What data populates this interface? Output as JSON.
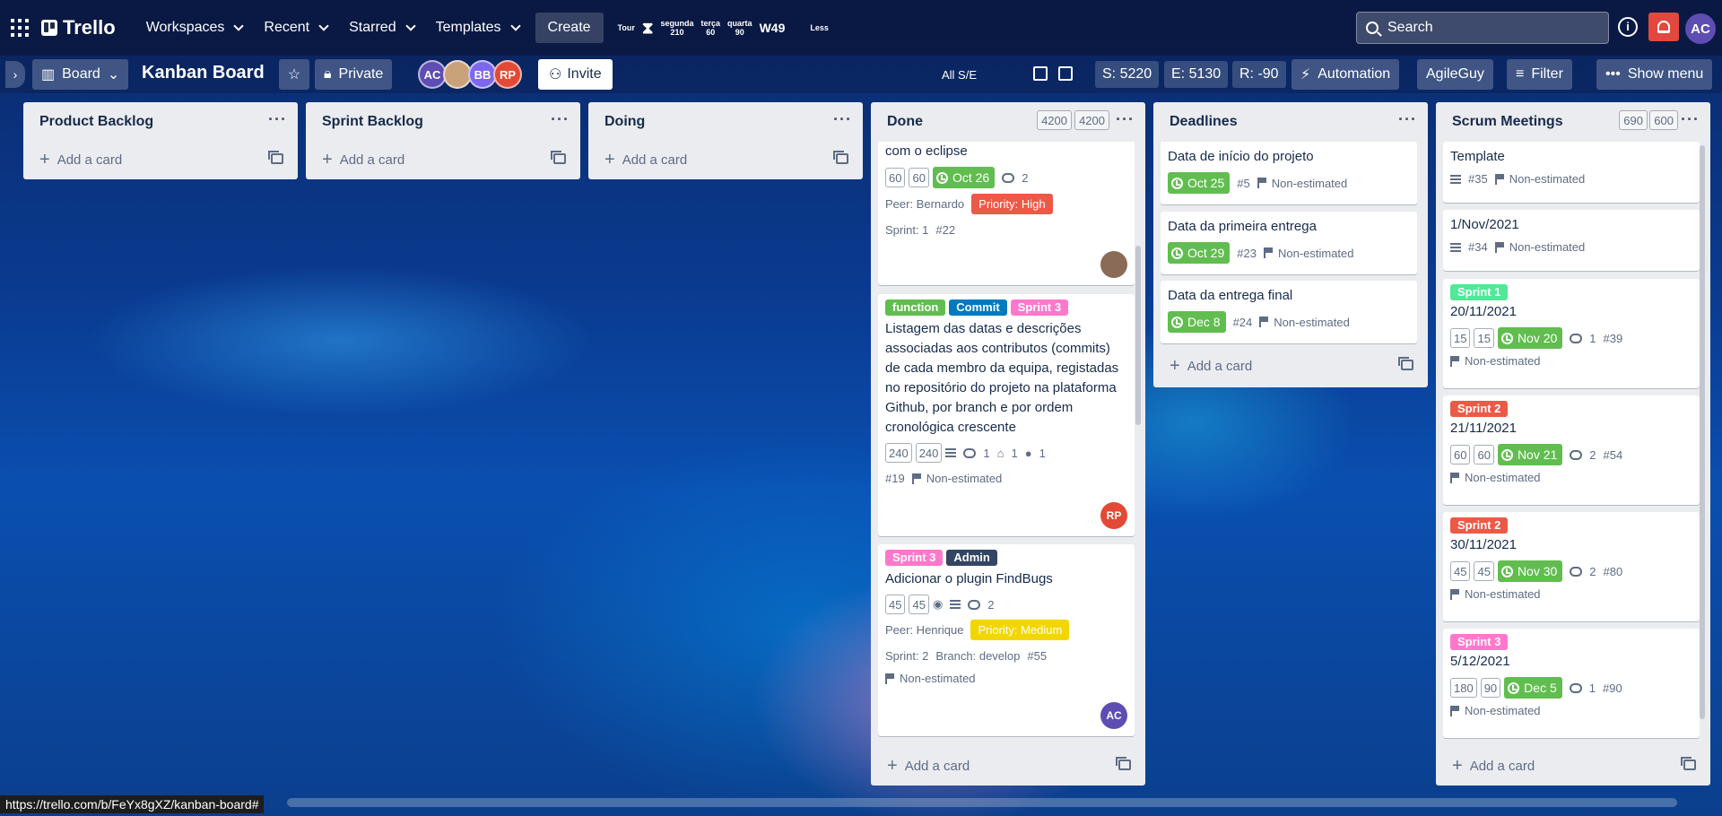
{
  "nav": {
    "brand": "Trello",
    "items": [
      "Workspaces",
      "Recent",
      "Starred",
      "Templates"
    ],
    "create": "Create",
    "widgets": {
      "tour": "Tour",
      "cols": [
        {
          "day": "segunda",
          "num": "210"
        },
        {
          "day": "terça",
          "num": "60"
        },
        {
          "day": "quarta",
          "num": "90"
        }
      ],
      "week": "W49",
      "less": "Less"
    },
    "search_placeholder": "Search",
    "user_initials": "AC"
  },
  "board": {
    "view": "Board",
    "title": "Kanban Board",
    "visibility": "Private",
    "members": [
      {
        "initials": "AC",
        "color": "#5e4db2"
      },
      {
        "initials": "",
        "color": "#c9a27a"
      },
      {
        "initials": "BB",
        "color": "#7b68ee"
      },
      {
        "initials": "RP",
        "color": "#e34935"
      }
    ],
    "invite": "Invite",
    "filter_scope": "All S/E",
    "stats": {
      "s": "S: 5220",
      "e": "E: 5130",
      "r": "R: -90"
    },
    "automation": "Automation",
    "user_pill": "AgileGuy",
    "filter": "Filter",
    "show_menu": "Show menu"
  },
  "common": {
    "add_card": "Add a card",
    "non_estimated": "Non-estimated"
  },
  "lists": {
    "product_backlog": {
      "title": "Product Backlog"
    },
    "sprint_backlog": {
      "title": "Sprint Backlog"
    },
    "doing": {
      "title": "Doing"
    },
    "done": {
      "title": "Done",
      "counts": [
        "4200",
        "4200"
      ],
      "cards": [
        {
          "title": "com o eclipse",
          "est": [
            "60",
            "60"
          ],
          "due": "Oct 26",
          "comments": "2",
          "peer": "Peer: Bernardo",
          "priority": "Priority: High",
          "sprint": "Sprint: 1",
          "id": "#22"
        },
        {
          "labels": [
            "function",
            "Commit",
            "Sprint 3"
          ],
          "title": "Listagem das datas e descrições associadas aos contributos (commits) de cada membro da equipa, registadas no repositório do projeto na plataforma Github, por branch e por ordem cronológica crescente",
          "est": [
            "240",
            "240"
          ],
          "comments": "1",
          "attachments": "1",
          "github": "1",
          "id": "#19",
          "non_estimated": "Non-estimated",
          "avatar": "RP"
        },
        {
          "labels": [
            "Sprint 3",
            "Admin"
          ],
          "title": "Adicionar o plugin FindBugs",
          "est": [
            "45",
            "45"
          ],
          "comments": "2",
          "peer": "Peer: Henrique",
          "priority": "Priority: Medium",
          "sprint": "Sprint: 2",
          "branch": "Branch: develop",
          "id": "#55",
          "non_estimated": "Non-estimated",
          "avatar": "AC"
        }
      ]
    },
    "deadlines": {
      "title": "Deadlines",
      "cards": [
        {
          "title": "Data de início do projeto",
          "due": "Oct 25",
          "id": "#5"
        },
        {
          "title": "Data da primeira entrega",
          "due": "Oct 29",
          "id": "#23"
        },
        {
          "title": "Data da entrega final",
          "due": "Dec 8",
          "id": "#24"
        }
      ]
    },
    "scrum": {
      "title": "Scrum Meetings",
      "counts": [
        "690",
        "600"
      ],
      "cards": [
        {
          "title": "Template",
          "id": "#35"
        },
        {
          "title": "1/Nov/2021",
          "id": "#34"
        },
        {
          "label": "Sprint 1",
          "title": "20/11/2021",
          "est": [
            "15",
            "15"
          ],
          "due": "Nov 20",
          "comments": "1",
          "id": "#39"
        },
        {
          "label": "Sprint 2",
          "title": "21/11/2021",
          "est": [
            "60",
            "60"
          ],
          "due": "Nov 21",
          "comments": "2",
          "id": "#54"
        },
        {
          "label": "Sprint 2",
          "title": "30/11/2021",
          "est": [
            "45",
            "45"
          ],
          "due": "Nov 30",
          "comments": "2",
          "id": "#80"
        },
        {
          "label": "Sprint 3",
          "title": "5/12/2021",
          "est": [
            "180",
            "90"
          ],
          "due": "Dec 5",
          "comments": "1",
          "id": "#90"
        }
      ]
    }
  },
  "colors": {
    "green": "#61bd4f",
    "blue": "#0079bf",
    "pink": "#ff78cb",
    "dark": "#344563",
    "red": "#eb5a46",
    "yellow": "#f2d600",
    "sprint1": "#51e898"
  },
  "status_url": "https://trello.com/b/FeYx8gXZ/kanban-board#"
}
